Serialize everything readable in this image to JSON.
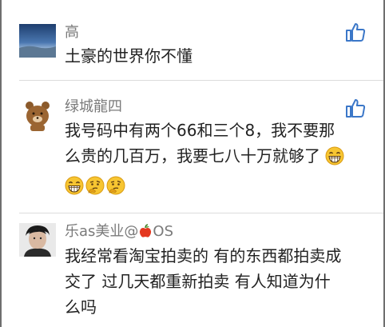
{
  "comments": [
    {
      "author": "高",
      "text": "土豪的世界你不懂"
    },
    {
      "author": "绿城龍四",
      "text_line1": "我号码中有两个66和三个8，我不要那",
      "text_line2": "么贵的几百万，我要七八十万就够了"
    },
    {
      "author_prefix": "乐as美业@",
      "author_suffix": "OS",
      "text_line1": "我经常看淘宝拍卖的 有的东西都拍卖成",
      "text_line2": "交了 过几天都重新拍卖 有人知道为什",
      "text_line3": "么吗"
    }
  ],
  "icons": {
    "like": "thumbs-up-icon",
    "laugh": "grinning-emoji-icon",
    "thinking": "thinking-emoji-icon",
    "apple": "apple-icon"
  },
  "colors": {
    "like_blue": "#3b77c8",
    "author_gray": "#7a7a7a",
    "text_dark": "#222222"
  }
}
